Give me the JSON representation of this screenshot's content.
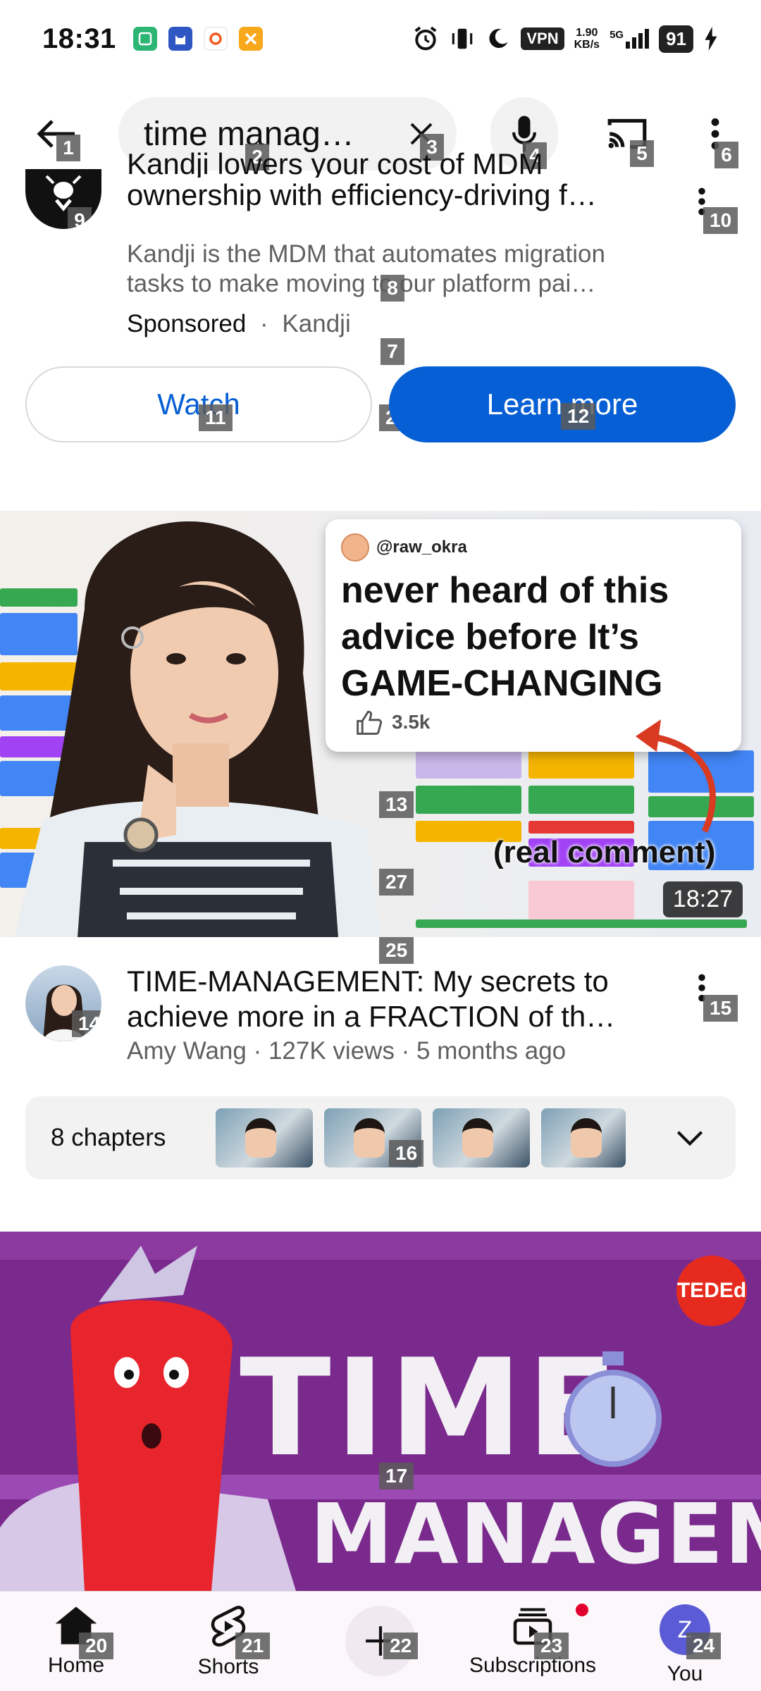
{
  "status_bar": {
    "time": "18:31",
    "vpn": "VPN",
    "speed_value": "1.90",
    "speed_unit": "KB/s",
    "network": "5G",
    "battery": "91"
  },
  "search": {
    "query": "time manag…"
  },
  "ad": {
    "title_line1": "Kandji lowers your cost of MDM",
    "title_line2": "ownership with efficiency-driving f…",
    "description": "Kandji is the MDM that automates migration tasks to make moving to our platform pai…",
    "sponsored": "Sponsored",
    "separator": "·",
    "advertiser": "Kandji",
    "watch_label": "Watch",
    "learn_more_label": "Learn more"
  },
  "video1": {
    "comment_user": "@raw_okra",
    "comment_text": "never heard of this advice before It’s GAME-CHANGING",
    "comment_likes": "3.5k",
    "overlay_note": "(real comment)",
    "duration": "18:27",
    "title_line1": "TIME-MANAGEMENT: My secrets to",
    "title_line2": "achieve more in a FRACTION of th…",
    "meta": "Amy Wang · 127K views · 5 months ago",
    "chapters_label": "8 chapters"
  },
  "video2": {
    "badge": "TEDEd",
    "title_big": "TIME",
    "title_sub": "MANAGEMENT"
  },
  "bottom_nav": {
    "items": [
      {
        "label": "Home",
        "icon": "home-icon"
      },
      {
        "label": "Shorts",
        "icon": "shorts-icon"
      },
      {
        "label": "",
        "icon": "plus-icon"
      },
      {
        "label": "Subscriptions",
        "icon": "subscriptions-icon"
      },
      {
        "label": "You",
        "icon": "avatar",
        "avatar_letter": "Z"
      }
    ]
  },
  "tags": [
    "1",
    "2",
    "3",
    "4",
    "5",
    "6",
    "7",
    "8",
    "9",
    "10",
    "11",
    "12",
    "13",
    "14",
    "15",
    "16",
    "17",
    "20",
    "21",
    "22",
    "23",
    "24",
    "25",
    "26",
    "27"
  ],
  "colors": {
    "accent_blue": "#065fd4",
    "youtube_red": "#e1002d",
    "ted_red": "#e62b1e"
  }
}
